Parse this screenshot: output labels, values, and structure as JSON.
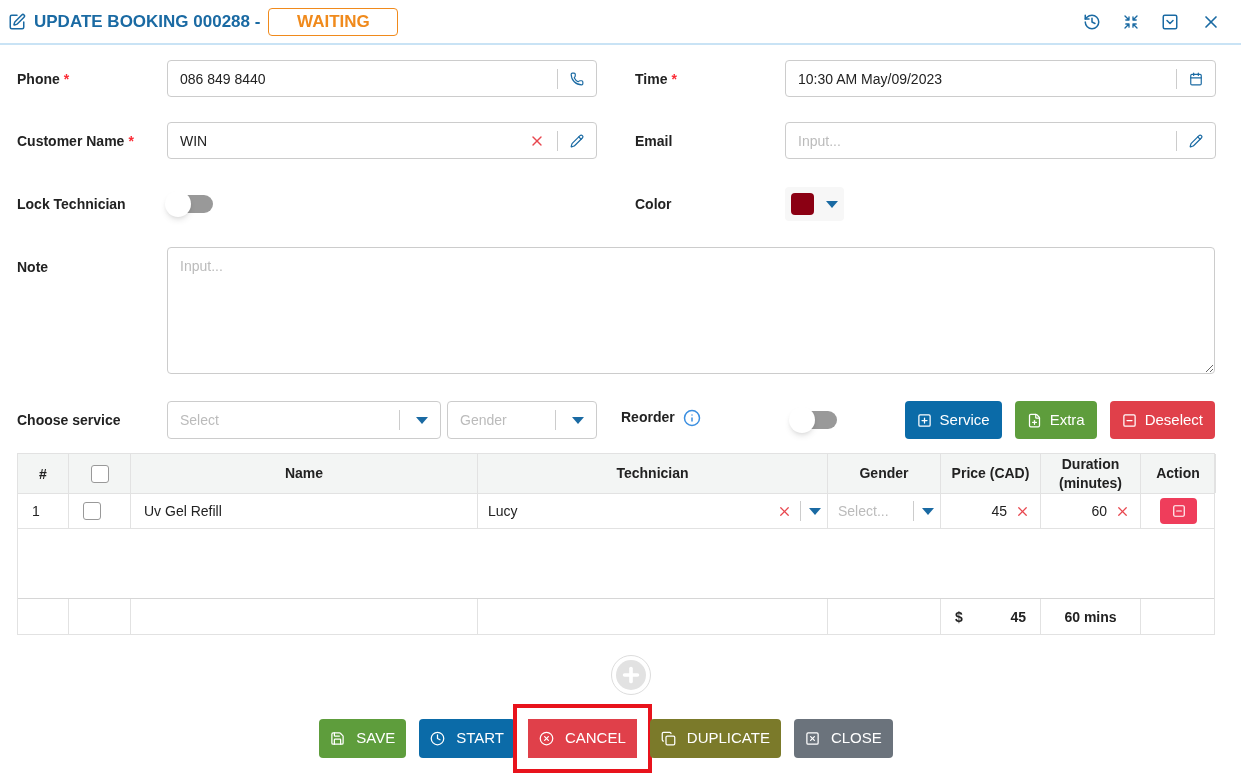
{
  "header": {
    "title": "UPDATE BOOKING 000288 -",
    "status": "WAITING"
  },
  "phone": {
    "label": "Phone",
    "required_mark": "*",
    "value": "086 849 8440"
  },
  "time": {
    "label": "Time",
    "required_mark": "*",
    "value": "10:30 AM May/09/2023"
  },
  "customer_name": {
    "label": "Customer Name",
    "required_mark": "*",
    "value": "WIN"
  },
  "email": {
    "label": "Email",
    "placeholder": "Input..."
  },
  "lock_technician": {
    "label": "Lock Technician",
    "on": false
  },
  "color": {
    "label": "Color",
    "color": "#8b0013"
  },
  "note": {
    "label": "Note",
    "placeholder": "Input..."
  },
  "choose_service": {
    "label": "Choose service",
    "service_placeholder": "Select",
    "gender_placeholder": "Gender"
  },
  "reorder": {
    "label": "Reorder",
    "on": false
  },
  "action_buttons": [
    {
      "label": "Service",
      "kind": "service"
    },
    {
      "label": "Extra",
      "kind": "extra"
    },
    {
      "label": "Deselect",
      "kind": "deselect"
    }
  ],
  "table": {
    "columns": [
      "#",
      "Name",
      "Technician",
      "Gender",
      "Price (CAD)",
      "Duration (minutes)",
      "Action"
    ],
    "all_checked": false,
    "rows": [
      {
        "index": "1",
        "checked": false,
        "name": "Uv Gel Refill",
        "technician": "Lucy",
        "gender_placeholder": "Select...",
        "price": "45",
        "duration": "60"
      }
    ],
    "footer": {
      "currency": "$",
      "price_total": "45",
      "duration_total": "60 mins"
    }
  },
  "footer_buttons": [
    {
      "label": "SAVE",
      "kind": "save",
      "highlighted": false
    },
    {
      "label": "START",
      "kind": "start",
      "highlighted": false
    },
    {
      "label": "CANCEL",
      "kind": "cancel",
      "highlighted": true
    },
    {
      "label": "DUPLICATE",
      "kind": "duplicate",
      "highlighted": false
    },
    {
      "label": "CLOSE",
      "kind": "close",
      "highlighted": false
    }
  ]
}
